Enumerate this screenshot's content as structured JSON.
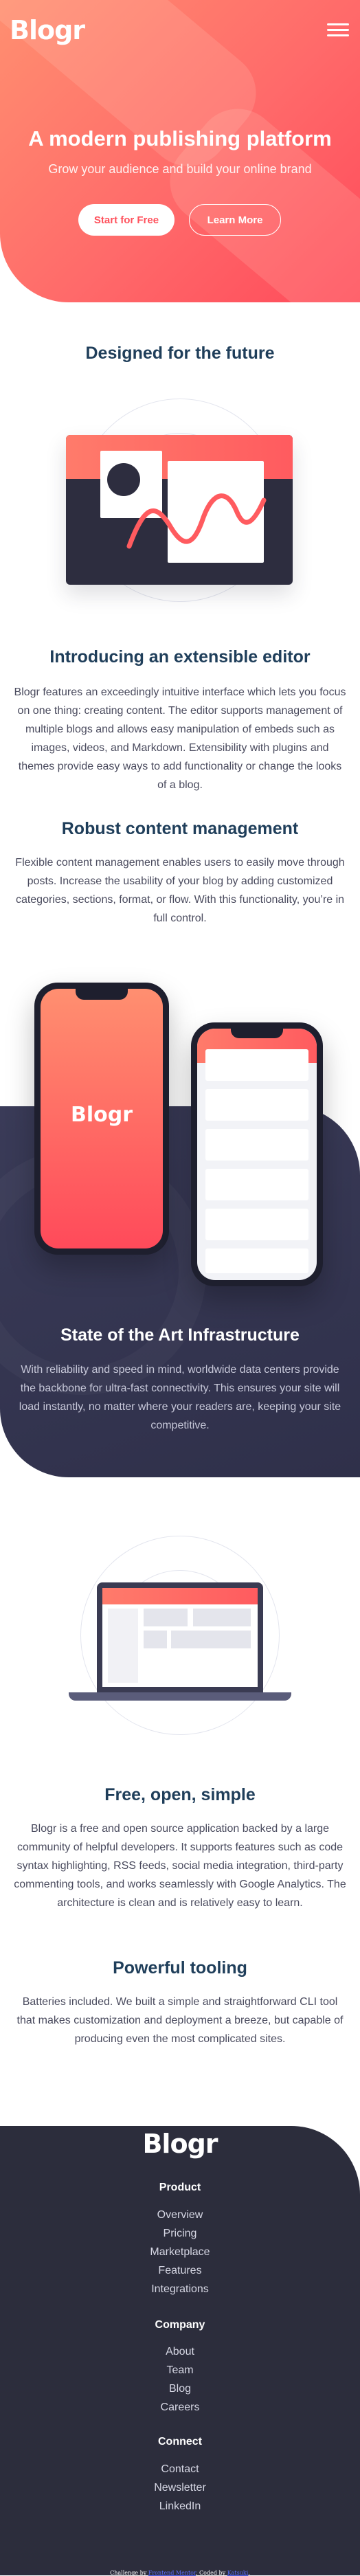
{
  "header": {
    "logo": "Blogr",
    "menu_icon": "hamburger-menu-icon",
    "accent_gradient": [
      "#ff8f70",
      "#ff4a5a"
    ]
  },
  "hero": {
    "title": "A modern publishing platform",
    "subtitle": "Grow your audience and build your online brand",
    "primary_button": "Start for Free",
    "secondary_button": "Learn More"
  },
  "sections": {
    "future_title": "Designed for the future",
    "extensible_title": "Introducing an extensible editor",
    "extensible_body": "Blogr features an exceedingly intuitive interface which lets you focus on one thing: creating content. The editor supports management of multiple blogs and allows easy manipulation of embeds such as images, videos, and Markdown. Extensibility with plugins and themes provide easy ways to add functionality or change the looks of a blog.",
    "robust_title": "Robust content management",
    "robust_body": "Flexible content management enables users to easily move through posts. Increase the usability of your blog by adding customized categories, sections, format, or flow. With this functionality, you’re in full control.",
    "phone_logo": "Blogr",
    "infra_title": "State of the Art Infrastructure",
    "infra_body": "With reliability and speed in mind, worldwide data centers provide the backbone for ultra-fast connectivity. This ensures your site will load instantly, no matter where your readers are, keeping your site competitive.",
    "free_title": "Free, open, simple",
    "free_body": "Blogr is a free and open source application backed by a large community of helpful developers. It supports features such as code syntax highlighting, RSS feeds, social media integration, third-party commenting tools, and works seamlessly with Google Analytics. The architecture is clean and is relatively easy to learn.",
    "tooling_title": "Powerful tooling",
    "tooling_body": "Batteries included. We built a simple and straightforward CLI tool that makes customization and deployment a breeze, but capable of producing even the most complicated sites."
  },
  "footer": {
    "logo": "Blogr",
    "product_heading": "Product",
    "product_links": [
      "Overview",
      "Pricing",
      "Marketplace",
      "Features",
      "Integrations"
    ],
    "company_heading": "Company",
    "company_links": [
      "About",
      "Team",
      "Blog",
      "Careers"
    ],
    "connect_heading": "Connect",
    "connect_links": [
      "Contact",
      "Newsletter",
      "LinkedIn"
    ]
  },
  "attribution": {
    "prefix": "Challenge by",
    "challenge_link": "Frontend Mentor",
    "middle": ". Coded by",
    "author_link": "Katsuki",
    "suffix": "."
  }
}
